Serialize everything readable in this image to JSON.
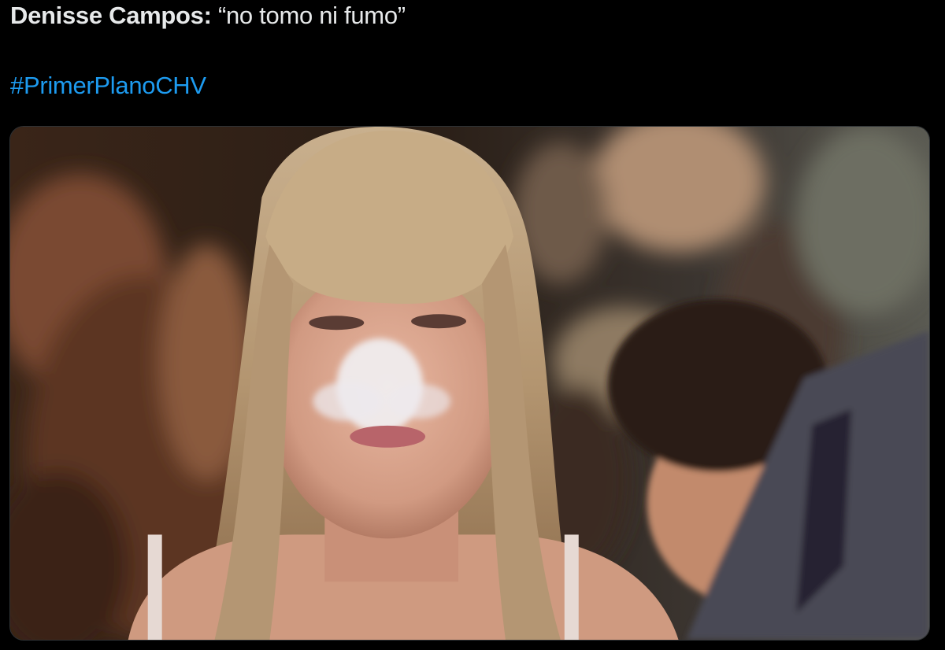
{
  "tweet": {
    "author_name": "Denisse Campos:",
    "quote": "“no tomo ni fumo”",
    "hashtag": "#PrimerPlanoCHV"
  },
  "media": {
    "type": "photo",
    "alt_icon": "photo-icon"
  },
  "colors": {
    "background": "#000000",
    "text": "#e7e9ea",
    "link": "#1d9bf0",
    "media_border": "#2f3336"
  }
}
